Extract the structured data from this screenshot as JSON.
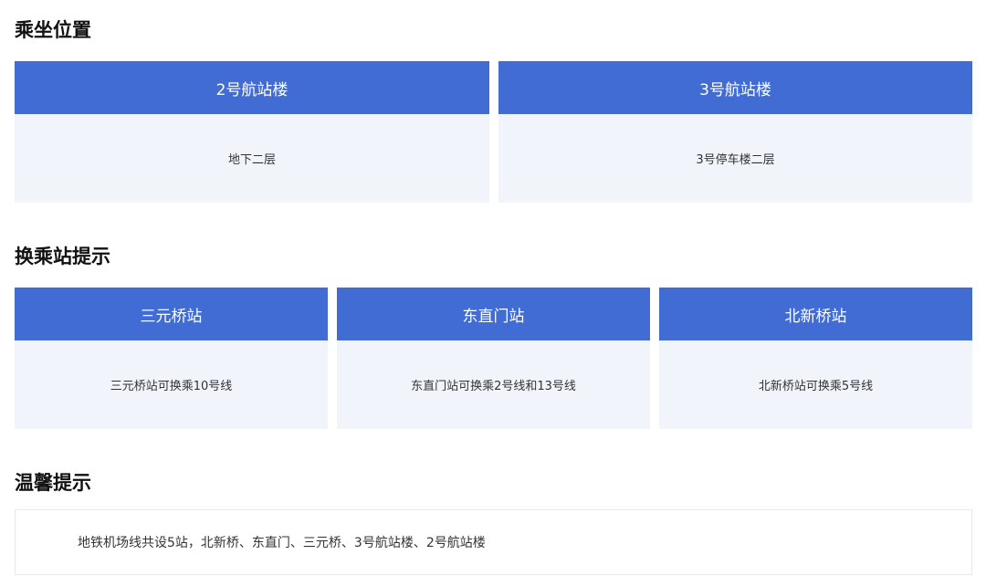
{
  "sections": {
    "boarding": {
      "title": "乘坐位置",
      "cards": [
        {
          "head": "2号航站楼",
          "body": "地下二层"
        },
        {
          "head": "3号航站楼",
          "body": "3号停车楼二层"
        }
      ]
    },
    "transfer": {
      "title": "换乘站提示",
      "cards": [
        {
          "head": "三元桥站",
          "body": "三元桥站可换乘10号线"
        },
        {
          "head": "东直门站",
          "body": "东直门站可换乘2号线和13号线"
        },
        {
          "head": "北新桥站",
          "body": "北新桥站可换乘5号线"
        }
      ]
    },
    "tips": {
      "title": "温馨提示",
      "text": "地铁机场线共设5站，北新桥、东直门、三元桥、3号航站楼、2号航站楼"
    }
  },
  "colors": {
    "card_head_bg": "#416cd4",
    "card_body_bg": "#f1f4fb"
  }
}
